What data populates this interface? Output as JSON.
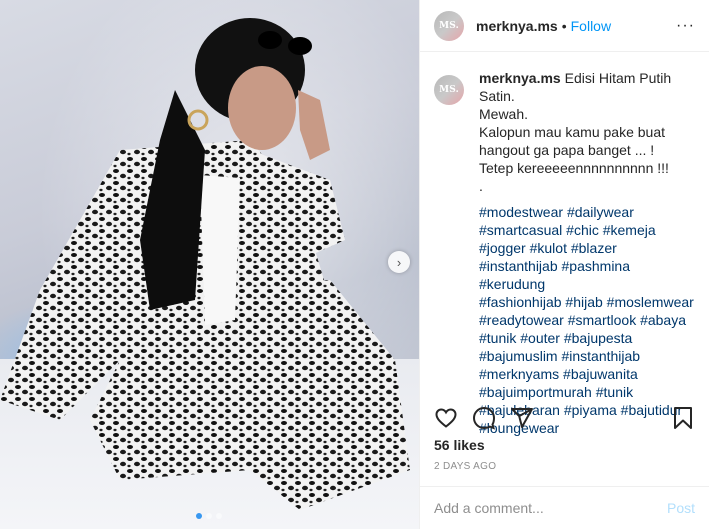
{
  "post": {
    "avatar_text": "MS.",
    "username": "merknya.ms",
    "separator": "•",
    "follow_label": "Follow",
    "more_label": "···"
  },
  "caption": {
    "username": "merknya.ms",
    "lines": [
      "Edisi Hitam Putih Satin.",
      "Mewah.",
      "Kalopun mau kamu pake buat",
      "hangout ga papa banget ... !",
      "Tetep kereeeeennnnnnnnnn !!!",
      "."
    ],
    "hashtag_lines": [
      [
        "#modestwear",
        "#dailywear"
      ],
      [
        "#smartcasual",
        "#chic",
        "#kemeja"
      ],
      [
        "#jogger",
        "#kulot",
        "#blazer"
      ],
      [
        "#instanthijab",
        "#pashmina",
        "#kerudung"
      ],
      [
        "#fashionhijab",
        "#hijab",
        "#moslemwear"
      ],
      [
        "#readytowear",
        "#smartlook",
        "#abaya"
      ],
      [
        "#tunik",
        "#outer",
        "#bajupesta"
      ],
      [
        "#bajumuslim",
        "#instanthijab"
      ],
      [
        "#merknyams",
        "#bajuwanita"
      ],
      [
        "#bajuimportmurah",
        "#tunik"
      ],
      [
        "#bajulebaran",
        "#piyama",
        "#bajutidur"
      ],
      [
        "#loungewear"
      ]
    ]
  },
  "actions": {
    "icons": [
      "heart-icon",
      "comment-icon",
      "share-icon",
      "bookmark-icon"
    ]
  },
  "stats": {
    "likes": "56 likes",
    "timestamp": "2 DAYS AGO"
  },
  "comment": {
    "placeholder": "Add a comment...",
    "post_label": "Post"
  },
  "carousel": {
    "next_icon": "chevron-right-icon",
    "dot_count": 3,
    "active_index": 0
  },
  "colors": {
    "link_blue": "#0095f6",
    "hashtag_blue": "#00376b",
    "muted": "#8e8e8e",
    "post_disabled": "#b2dffc"
  }
}
